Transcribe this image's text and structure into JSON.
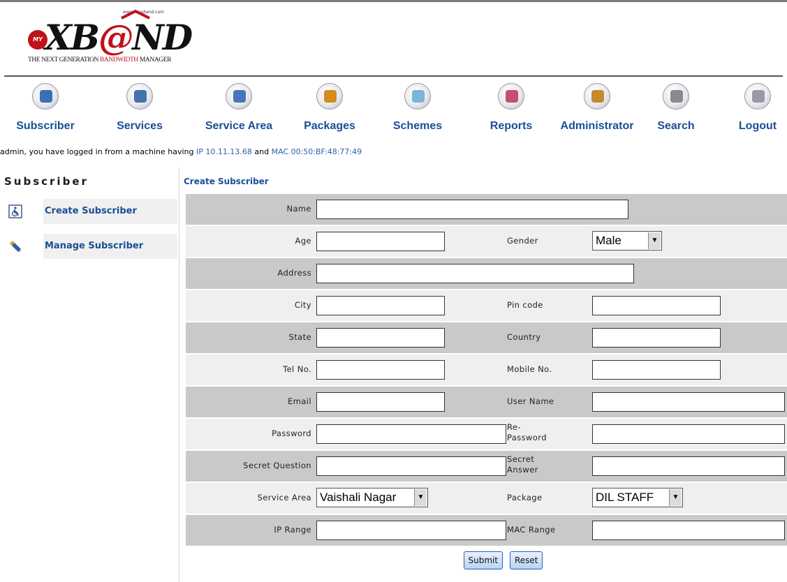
{
  "logo": {
    "url_text": "www.myxband.com",
    "my": "MY",
    "brand_pre": "XB",
    "brand_at": "@",
    "brand_post": "ND",
    "tagline_pre": "THE NEXT GENERATION ",
    "tagline_red": "BANDWIDTH",
    "tagline_post": " MANAGER"
  },
  "nav": [
    {
      "label": "Subscriber",
      "icon": "subscriber-icon",
      "color": "#3b6fb6"
    },
    {
      "label": "Services",
      "icon": "services-icon",
      "color": "#4a6fb0"
    },
    {
      "label": "Service Area",
      "icon": "service-area-icon",
      "color": "#4b73b8"
    },
    {
      "label": "Packages",
      "icon": "packages-icon",
      "color": "#d58b1e"
    },
    {
      "label": "Schemes",
      "icon": "schemes-icon",
      "color": "#7ab6d8"
    },
    {
      "label": "Reports",
      "icon": "reports-icon",
      "color": "#c45070"
    },
    {
      "label": "Administrator",
      "icon": "administrator-icon",
      "color": "#c78a2c"
    },
    {
      "label": "Search",
      "icon": "search-icon",
      "color": "#8a8a8a"
    },
    {
      "label": "Logout",
      "icon": "logout-icon",
      "color": "#9a9aa6"
    }
  ],
  "login_info": {
    "pre": "admin, you have logged in from a machine having ",
    "ip": "IP 10.11.13.68",
    "mid": " and ",
    "mac": "MAC 00:50:BF:48:77:49"
  },
  "sidebar": {
    "title": "Subscriber",
    "items": [
      {
        "label": "Create Subscriber",
        "icon": "wheelchair-icon"
      },
      {
        "label": "Manage Subscriber",
        "icon": "pencil-icon"
      }
    ]
  },
  "form": {
    "title": "Create Subscriber",
    "labels": {
      "name": "Name",
      "age": "Age",
      "gender": "Gender",
      "address": "Address",
      "city": "City",
      "pincode": "Pin code",
      "state": "State",
      "country": "Country",
      "tel": "Tel No.",
      "mobile": "Mobile No.",
      "email": "Email",
      "username": "User Name",
      "password": "Password",
      "repassword_1": "Re-",
      "repassword_2": "Password",
      "secret_q": "Secret Question",
      "secret_a_1": "Secret",
      "secret_a_2": "Answer",
      "service_area": "Service Area",
      "package": "Package",
      "ip_range": "IP Range",
      "mac_range": "MAC Range"
    },
    "gender_value": "Male",
    "service_area_value": "Vaishali Nagar",
    "package_value": "DIL STAFF",
    "submit": "Submit",
    "reset": "Reset"
  }
}
